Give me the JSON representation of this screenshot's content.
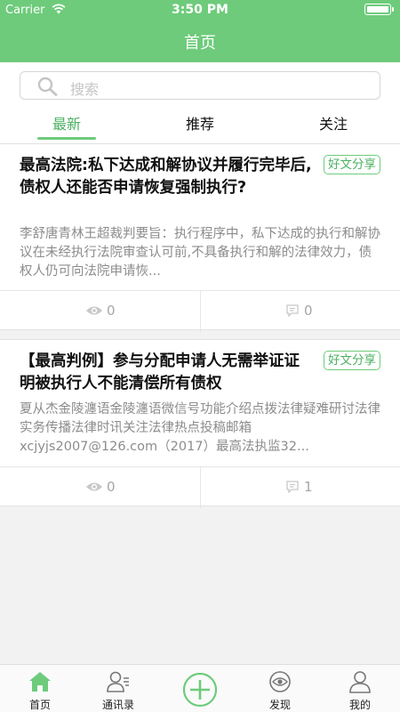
{
  "status_bar": {
    "carrier": "Carrier",
    "time": "3:50 PM"
  },
  "header": {
    "title": "首页"
  },
  "search": {
    "placeholder": "搜索"
  },
  "tabs": [
    {
      "label": "最新",
      "active": true
    },
    {
      "label": "推荐",
      "active": false
    },
    {
      "label": "关注",
      "active": false
    }
  ],
  "articles": [
    {
      "title": "最高法院:私下达成和解协议并履行完毕后,债权人还能否申请恢复强制执行?",
      "tag": "好文分享",
      "summary": "李舒唐青林王超裁判要旨：执行程序中，私下达成的执行和解协议在未经执行法院审查认可前,不具备执行和解的法律效力，债权人仍可向法院申请恢...",
      "views": "0",
      "comments": "0"
    },
    {
      "title": "【最高判例】参与分配申请人无需举证证明被执行人不能清偿所有债权",
      "tag": "好文分享",
      "summary": "夏从杰金陵瀍语金陵瀍语微信号功能介绍点拨法律疑难研讨法律实务传播法律时讯关注法律热点投稿邮箱xcjyjs2007@126.com（2017）最高法执监32...",
      "views": "0",
      "comments": "1"
    }
  ],
  "tabbar": {
    "home": "首页",
    "contacts": "通讯录",
    "discover": "发现",
    "mine": "我的"
  },
  "colors": {
    "brand": "#6ecb7b",
    "brand_text": "#4bb061"
  }
}
